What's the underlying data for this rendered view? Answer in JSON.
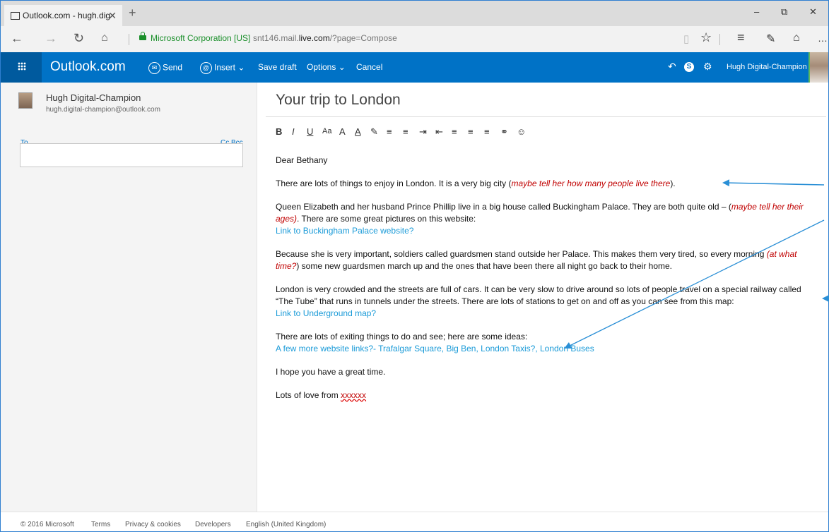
{
  "browser": {
    "tab_title": "Outlook.com - hugh.dig",
    "tab_close": "✕",
    "new_tab": "+",
    "window_controls": [
      "–",
      "⧉",
      "✕"
    ],
    "cert_label": "Microsoft Corporation [US]",
    "url_prefix": "snt146.mail.",
    "url_domain": "live.com",
    "url_suffix": "/?page=Compose",
    "accent": "#2f7fd0"
  },
  "outlook": {
    "brand": "Outlook.com",
    "commands": {
      "send": "Send",
      "insert": "Insert",
      "save_draft": "Save draft",
      "options": "Options",
      "cancel": "Cancel"
    },
    "user_name": "Hugh Digital-Champion",
    "header_color": "#0072c6"
  },
  "sender": {
    "name": "Hugh Digital-Champion",
    "email": "hugh.digital-champion@outlook.com"
  },
  "recipients": {
    "to_label": "To",
    "cc_bcc_label": "Cc  Bcc",
    "to_value": ""
  },
  "compose": {
    "subject": "Your trip to London",
    "formatting_toolbar": [
      "B",
      "I",
      "U",
      "Aa",
      "A",
      "A",
      "✎",
      "≡",
      "≡",
      "⇥",
      "⇤",
      "≡",
      "≡",
      "≡",
      "⚭",
      "☺"
    ],
    "greeting": "Dear Bethany",
    "p1_text": "There are lots of things to enjoy in London.  It is a very big city (",
    "p1_note": "maybe tell her how many people live there",
    "p1_end": ").",
    "p2_text": "Queen Elizabeth and her husband Prince Phillip live in a big house called Buckingham Palace.  They are both quite old – (",
    "p2_note": "maybe tell her their ages)",
    "p2_end": ".  There are some great pictures on this website:",
    "p2_link": "Link to Buckingham Palace website?",
    "p3_text": "Because she is very important, soldiers called guardsmen stand outside her Palace.  This makes them very tired, so every morning ",
    "p3_note": "(at what time?",
    "p3_end": ") some new guardsmen march up and the ones that have been there all night go back to their home.",
    "p4_text": "London is very crowded and the streets are full of cars.  It can be very slow to drive around so lots of people travel on a special railway called “The Tube” that runs in tunnels under the streets.  There are lots of stations to get on and off as you can see from this map:",
    "p4_link": "Link to Underground map?",
    "p5_text": "There are lots of exiting things to do and see; here are some ideas:",
    "p5_link": "A few more website links?- Trafalgar Square, Big Ben, London Taxis?, London Buses",
    "p6_text": "I hope you have a great time.",
    "sign_text": "Lots of love from ",
    "sign_name": "xxxxxx"
  },
  "footer": {
    "copyright": "© 2016 Microsoft",
    "terms": "Terms",
    "privacy": "Privacy & cookies",
    "developers": "Developers",
    "language": "English (United Kingdom)"
  },
  "annotation_color": "#2a8fd6"
}
